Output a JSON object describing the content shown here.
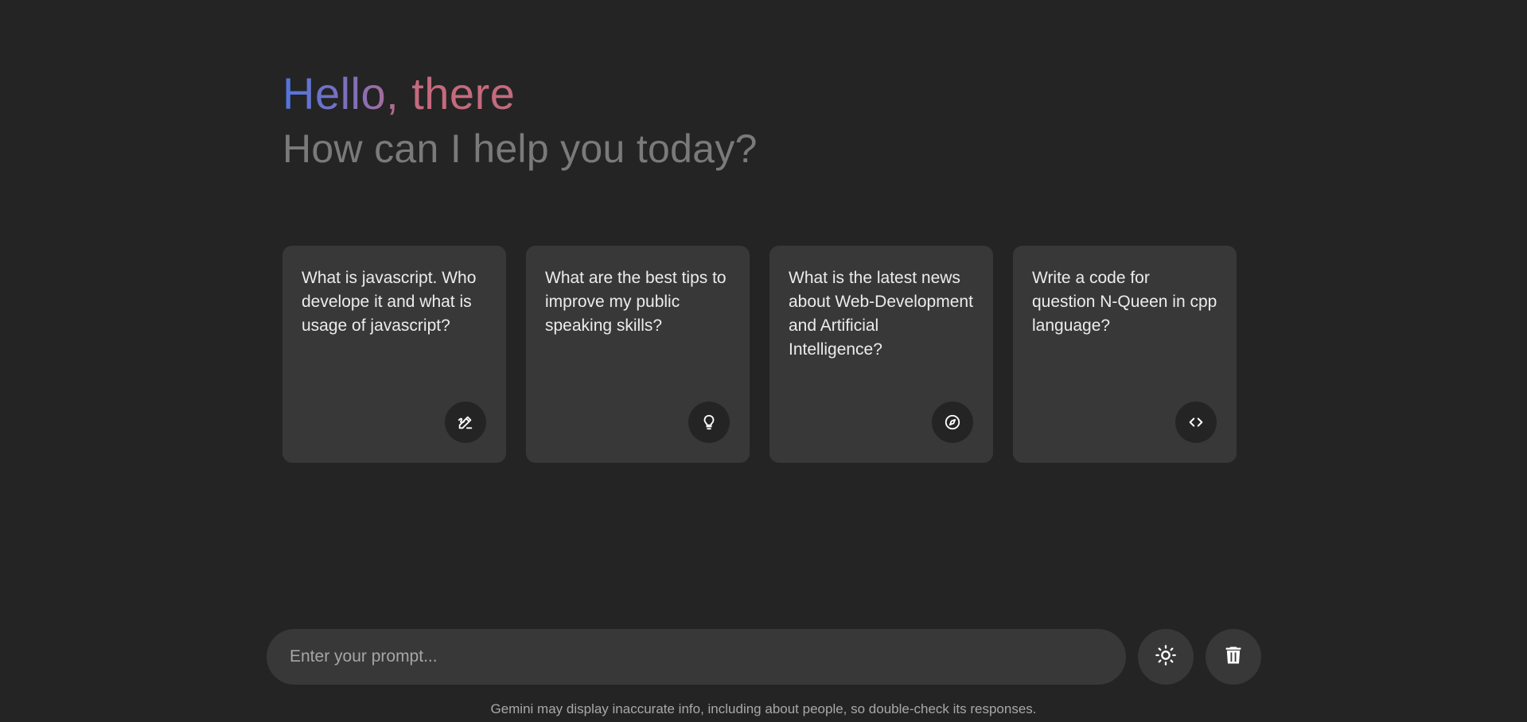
{
  "header": {
    "greeting": "Hello, there",
    "subtitle": "How can I help you today?"
  },
  "suggestions": [
    {
      "text": "What is javascript. Who develope it and what is usage of javascript?",
      "icon": "draw-icon"
    },
    {
      "text": "What are the best tips to improve my public speaking skills?",
      "icon": "lightbulb-icon"
    },
    {
      "text": "What is the latest news about Web-Development and Artificial Intelligence?",
      "icon": "explore-icon"
    },
    {
      "text": "Write a code for question N-Queen in cpp language?",
      "icon": "code-icon"
    }
  ],
  "prompt": {
    "placeholder": "Enter your prompt...",
    "value": ""
  },
  "actions": {
    "theme_toggle_icon": "sun-icon",
    "delete_chat_icon": "trash-icon"
  },
  "disclaimer": "Gemini may display inaccurate info, including about people, so double-check its responses.",
  "colors": {
    "background": "#242424",
    "card": "#383838",
    "gradient_start": "#4f75e0",
    "gradient_end": "#c56a7e",
    "subtitle": "#7a7a7a"
  }
}
